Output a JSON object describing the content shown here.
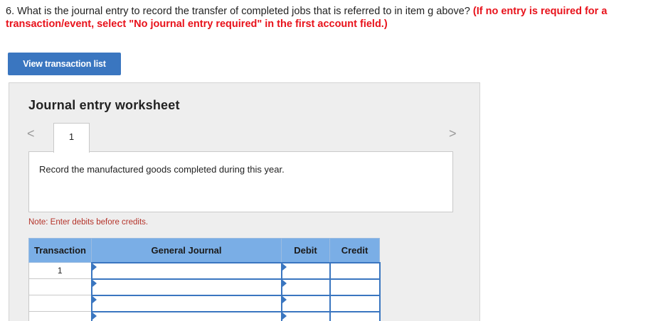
{
  "question": {
    "text": "6. What is the journal entry to record the transfer of completed jobs that is referred to in item g above? ",
    "requirement": "(If no entry is required for a transaction/event, select \"No journal entry required\" in the first account field.)"
  },
  "toolbar": {
    "view_transactions_label": "View transaction list"
  },
  "worksheet": {
    "title": "Journal entry worksheet",
    "prev_icon": "<",
    "next_icon": ">",
    "tabs": [
      {
        "label": "1"
      }
    ],
    "instruction": "Record the manufactured goods completed during this year.",
    "note": "Note: Enter debits before credits."
  },
  "journal_table": {
    "headers": {
      "transaction": "Transaction",
      "general_journal": "General Journal",
      "debit": "Debit",
      "credit": "Credit"
    },
    "rows": [
      {
        "transaction": "1",
        "account": "",
        "debit": "",
        "credit": ""
      },
      {
        "transaction": "",
        "account": "",
        "debit": "",
        "credit": ""
      },
      {
        "transaction": "",
        "account": "",
        "debit": "",
        "credit": ""
      },
      {
        "transaction": "",
        "account": "",
        "debit": "",
        "credit": ""
      }
    ]
  },
  "colors": {
    "accent": "#3a76c0",
    "header": "#7aaee6",
    "requirement": "#e8121b",
    "note": "#b4332a"
  }
}
